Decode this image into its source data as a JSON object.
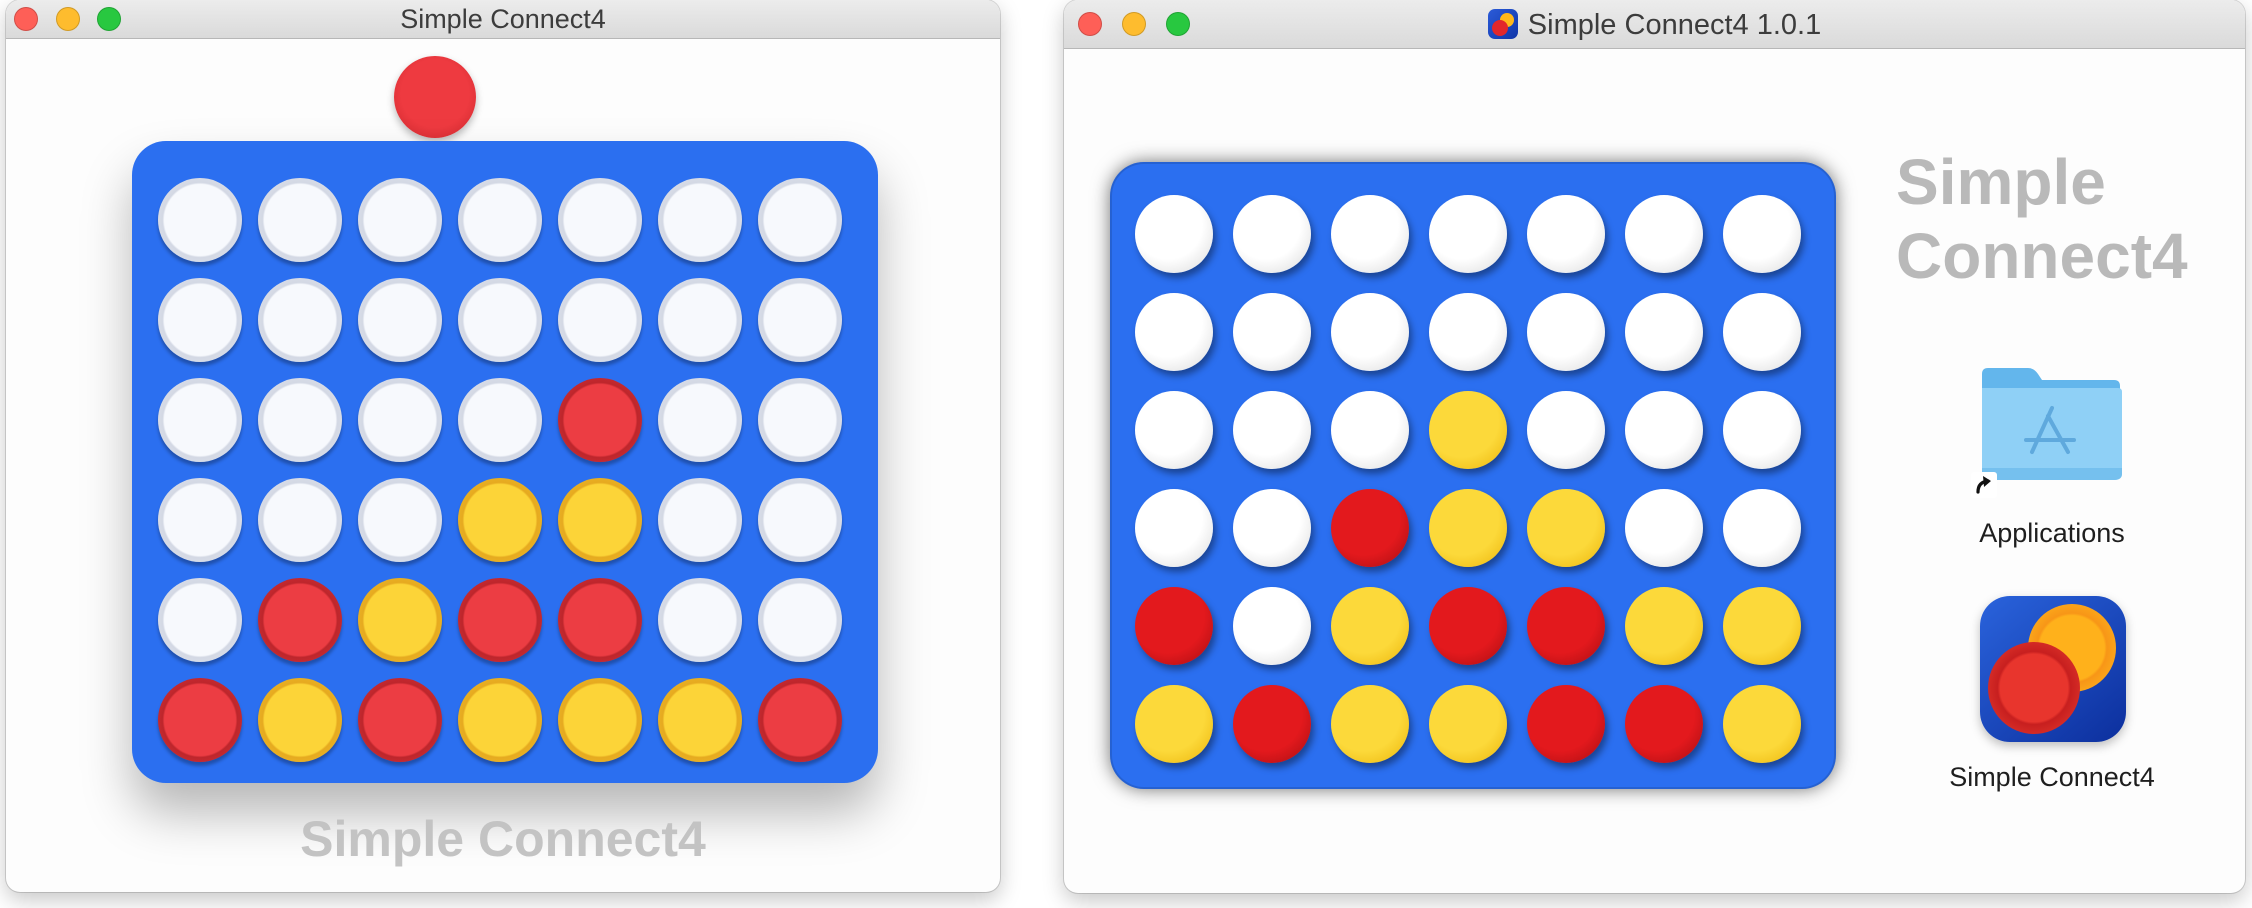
{
  "colors": {
    "board_blue": "#2b6ff0",
    "red_disc": "#e3191d",
    "yellow_disc": "#fcd93a",
    "drop_marker": "#55d4ff",
    "wordmark_gray": "#c3c3c3"
  },
  "left_window": {
    "title": "Simple Connect4",
    "current_turn_disc": "red",
    "wordmark": "Simple Connect4",
    "board": [
      [
        "empty",
        "empty",
        "empty",
        "empty",
        "empty",
        "empty",
        "empty"
      ],
      [
        "empty",
        "empty",
        "empty",
        "empty",
        "empty",
        "empty",
        "empty"
      ],
      [
        "empty",
        "empty",
        "empty",
        "empty",
        "red",
        "empty",
        "empty"
      ],
      [
        "empty",
        "empty",
        "empty",
        "yellow",
        "yellow",
        "empty",
        "empty"
      ],
      [
        "empty",
        "red",
        "yellow",
        "red",
        "red",
        "empty",
        "empty"
      ],
      [
        "red",
        "yellow",
        "red",
        "yellow",
        "yellow",
        "yellow",
        "red"
      ]
    ]
  },
  "right_window": {
    "title": "Simple Connect4 1.0.1",
    "wordmark": "Simple\nConnect4",
    "applications_label": "Applications",
    "app_label": "Simple Connect4",
    "icons": [
      "applications-folder-icon",
      "alias-arrow-icon",
      "simple-connect4-app-icon"
    ],
    "board": [
      [
        "empty",
        "empty",
        "empty",
        "empty",
        "empty",
        "empty",
        "empty"
      ],
      [
        "empty",
        "empty",
        "empty",
        "empty",
        "empty",
        "empty",
        "empty"
      ],
      [
        "empty",
        "empty",
        "empty",
        "yellow",
        "empty",
        "empty",
        "empty"
      ],
      [
        "empty",
        "empty",
        "red",
        "yellow",
        "yellow",
        "empty",
        "empty"
      ],
      [
        "red",
        "empty",
        "yellow",
        "red",
        "red",
        "yellow",
        "yellow"
      ],
      [
        "yellow",
        "red",
        "yellow",
        "yellow",
        "red",
        "red",
        "yellow"
      ]
    ]
  }
}
